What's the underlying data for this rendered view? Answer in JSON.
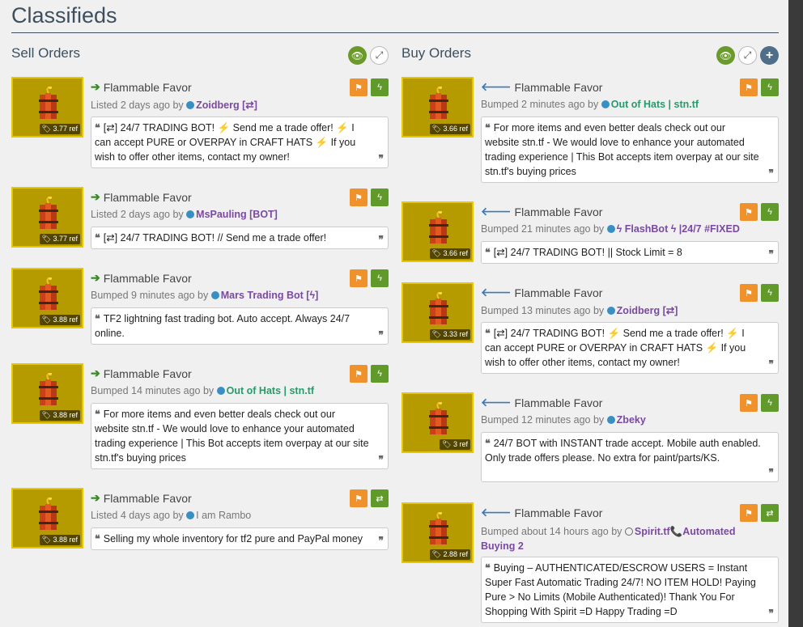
{
  "page": {
    "title": "Classifieds"
  },
  "sell": {
    "title": "Sell Orders",
    "listings": [
      {
        "name": "Flammable Favor",
        "price": "3.77 ref",
        "meta_prefix": "Listed 2 days ago by",
        "user": "Zoidberg [⇄]",
        "user_style": "purple",
        "desc": "[⇄] 24/7 TRADING BOT! ⚡ Send me a trade offer! ⚡ I can accept PURE or OVERPAY in CRAFT HATS ⚡ If you wish to offer other items, contact my owner!",
        "action": "bolt"
      },
      {
        "name": "Flammable Favor",
        "price": "3.77 ref",
        "meta_prefix": "Listed 2 days ago by",
        "user": "MsPauling [BOT]",
        "user_style": "purple",
        "desc": "[⇄] 24/7 TRADING BOT! // Send me a trade offer!",
        "action": "bolt"
      },
      {
        "name": "Flammable Favor",
        "price": "3.88 ref",
        "meta_prefix": "Bumped 9 minutes ago by",
        "user": "Mars Trading Bot [ϟ]",
        "user_style": "purple",
        "desc": "TF2 lightning fast trading bot. Auto accept. Always 24/7 online.",
        "action": "bolt"
      },
      {
        "name": "Flammable Favor",
        "price": "3.88 ref",
        "meta_prefix": "Bumped 14 minutes ago by",
        "user": "Out of Hats | stn.tf",
        "user_style": "green",
        "desc": "For more items and even better deals check out our website stn.tf - We would love to enhance your automated trading experience | This Bot accepts item overpay at our site stn.tf's buying prices",
        "action": "bolt"
      },
      {
        "name": "Flammable Favor",
        "price": "3.88 ref",
        "meta_prefix": "Listed 4 days ago by",
        "user": "I am Rambo",
        "user_style": "gray",
        "desc": "Selling my whole inventory for tf2 pure and PayPal money",
        "action": "trade"
      }
    ]
  },
  "buy": {
    "title": "Buy Orders",
    "listings": [
      {
        "name": "Flammable Favor",
        "price": "3.66 ref",
        "meta_prefix": "Bumped 2 minutes ago by",
        "user": "Out of Hats | stn.tf",
        "user_style": "green",
        "desc": "For more items and even better deals check out our website stn.tf - We would love to enhance your automated trading experience | This Bot accepts item overpay at our site stn.tf's buying prices",
        "action": "bolt"
      },
      {
        "name": "Flammable Favor",
        "price": "3.66 ref",
        "meta_prefix": "Bumped 21 minutes ago by",
        "user": "ϟ FlashBot ϟ |24/7 #FIXED",
        "user_style": "purple",
        "desc": "[⇄] 24/7 TRADING BOT! || Stock Limit = 8",
        "action": "bolt"
      },
      {
        "name": "Flammable Favor",
        "price": "3.33 ref",
        "meta_prefix": "Bumped 13 minutes ago by",
        "user": "Zoidberg [⇄]",
        "user_style": "purple",
        "desc": "[⇄] 24/7 TRADING BOT! ⚡ Send me a trade offer! ⚡ I can accept PURE or OVERPAY in CRAFT HATS ⚡ If you wish to offer other items, contact my owner!",
        "action": "bolt"
      },
      {
        "name": "Flammable Favor",
        "price": "3 ref",
        "meta_prefix": "Bumped 12 minutes ago by",
        "user": "Zbeky",
        "user_style": "purple",
        "desc": "24/7 BOT with INSTANT trade accept. Mobile auth enabled. Only trade offers please. No extra for paint/parts/KS.",
        "action": "bolt"
      },
      {
        "name": "Flammable Favor",
        "price": "2.88 ref",
        "meta_prefix": "Bumped about 14 hours ago by",
        "user": "Spirit.tf📞Automated Buying 2",
        "user_style": "purple-hollow",
        "desc": "Buying – AUTHENTICATED/ESCROW USERS = Instant Super Fast Automatic Trading 24/7! NO ITEM HOLD! Paying Pure > No Limits (Mobile Authenticated)! Thank You For Shopping With Spirit =D Happy Trading =D",
        "action": "trade"
      }
    ]
  }
}
